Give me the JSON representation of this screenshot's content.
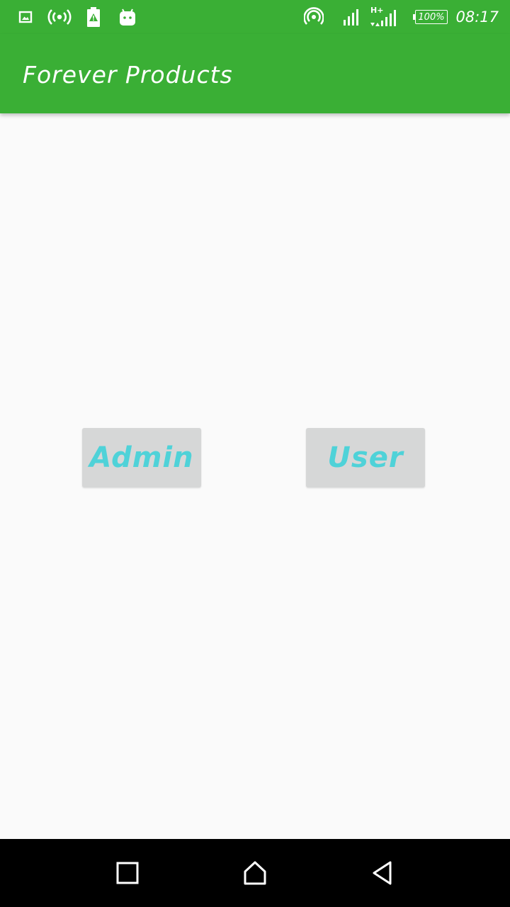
{
  "status_bar": {
    "battery": "100%",
    "time": "08:17",
    "network": "H+",
    "icons": [
      "image-icon",
      "wireless-broadcast-icon",
      "battery-alert-icon",
      "android-icon",
      "hotspot-icon",
      "signal-icon",
      "mobile-data-icon",
      "battery-icon"
    ]
  },
  "app_bar": {
    "title": "Forever Products"
  },
  "main": {
    "admin_label": "Admin",
    "user_label": "User"
  },
  "nav_bar": {
    "icons": [
      "recents-icon",
      "home-icon",
      "back-icon"
    ]
  },
  "colors": {
    "primary": "#3aaf35",
    "button_background": "#d6d7d7",
    "button_text": "#4fd2d8",
    "background": "#fafafa"
  }
}
